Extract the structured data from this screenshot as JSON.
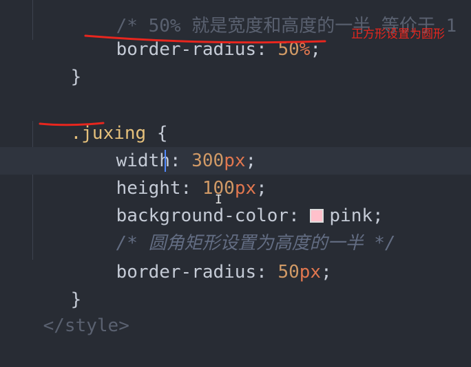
{
  "code": {
    "line_top_partial": "/* 50% 就是宽度和高度的一半 等价于 1",
    "line_radius_percent": {
      "prop": "border-radius",
      "value_num": "50",
      "value_unit": "%",
      "end": ";"
    },
    "close_brace_1": "}",
    "selector": ".juxing",
    "open_brace": "{",
    "width": {
      "prop": "width",
      "num": "300",
      "unit": "px",
      "end": ";"
    },
    "height": {
      "prop": "height",
      "num": "100",
      "unit": "px",
      "end": ";"
    },
    "bg": {
      "prop": "background-color",
      "value": "pink",
      "end": ";",
      "swatch_color": "#ffc0cb"
    },
    "comment": "/* 圆角矩形设置为高度的一半 */",
    "radius_px": {
      "prop": "border-radius",
      "num": "50",
      "unit": "px",
      "end": ";"
    },
    "close_brace_2": "}",
    "style_close_partial": "</style>"
  },
  "annotation": {
    "text": "正方形设置为圆形",
    "color": "#e8261e"
  },
  "colors": {
    "background": "#282c34",
    "property": "#c5cbd6",
    "number": "#d19a66",
    "unit": "#e2774f",
    "selector": "#e5c07b",
    "comment": "#636d83",
    "ink": "#e8261e"
  }
}
